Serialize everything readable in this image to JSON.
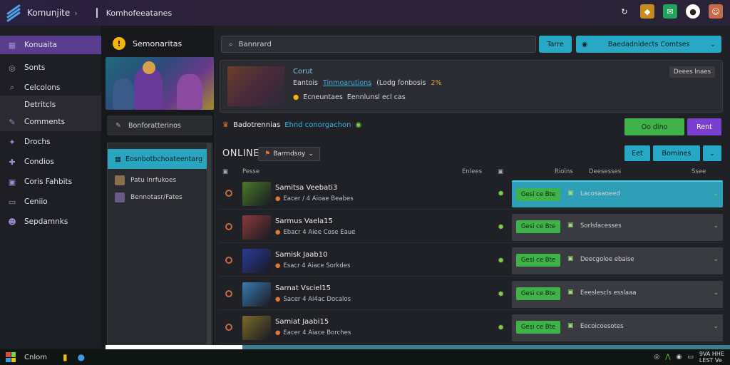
{
  "app": {
    "title": "Komunjite",
    "breadcrumb": "Komhofeeatanes"
  },
  "top_actions": [
    {
      "icon": "refresh-icon",
      "color": "#2a2236",
      "glyph": "↻"
    },
    {
      "icon": "badge-icon",
      "color": "#c78a1e",
      "glyph": "◆"
    },
    {
      "icon": "chat-icon",
      "color": "#1fa35a",
      "glyph": "✉"
    },
    {
      "icon": "user-icon",
      "color": "#ffffff",
      "glyph": "●"
    },
    {
      "icon": "avatar-icon",
      "color": "#c46a4a",
      "glyph": "☺"
    }
  ],
  "sidebar": {
    "items": [
      {
        "label": "Konuaita",
        "icon": "grid-icon",
        "glyph": "▦",
        "state": "active"
      },
      {
        "label": "Sonts",
        "icon": "compass-icon",
        "glyph": "◎",
        "state": ""
      },
      {
        "label": "Celcolons",
        "icon": "search-icon",
        "glyph": "⌕",
        "state": ""
      },
      {
        "label": "Detritcls",
        "icon": "",
        "glyph": "",
        "state": "sub"
      },
      {
        "label": "Comments",
        "icon": "chat-icon",
        "glyph": "✎",
        "state": "sub"
      },
      {
        "label": "Drochs",
        "icon": "sword-icon",
        "glyph": "✦",
        "state": ""
      },
      {
        "label": "Condios",
        "icon": "controller-icon",
        "glyph": "✚",
        "state": ""
      },
      {
        "label": "Coris Fahbits",
        "icon": "cube-icon",
        "glyph": "▣",
        "state": ""
      },
      {
        "label": "Ceniio",
        "icon": "monitor-icon",
        "glyph": "▭",
        "state": ""
      },
      {
        "label": "Sepdamnks",
        "icon": "avatar-icon",
        "glyph": "☻",
        "state": ""
      }
    ]
  },
  "channels": {
    "header": "Semonaritas",
    "box_label": "Bonforatterinos",
    "selected": "Eosnbotbchoateentarg",
    "rows": [
      "Patu Inrfukoes",
      "Bennotasr/Fates"
    ]
  },
  "main": {
    "search_placeholder": "Bannrard",
    "search_button": "Tarre",
    "dropdown_label": "Baedadnidects Comtses",
    "featured": {
      "title": "Corut",
      "line1_a": "Eantois",
      "line1_hl": "Tinmoarutions",
      "line1_b": "(Lodg fonbosis",
      "line1_pct": "2%",
      "line2": "Ecneuntaes",
      "line2_b": "Eennlunsl ecl cas",
      "badge": "Deees lnaes"
    },
    "info": {
      "left": "Badotrennias",
      "highlight": "Ehnd conorgachon"
    },
    "green_button": "Oo dino",
    "purple_button": "Rent",
    "online_label": "ONLINE",
    "online_filter": "Barmdsoy",
    "btn_small": "Eet",
    "btn_medium": "Bomines",
    "table_headers": {
      "col1": "Pesse",
      "col2": "Enlees",
      "col3": "Riolns",
      "col4": "Deesesses",
      "col5": "Ssee"
    },
    "rows": [
      {
        "name": "Samitsa Veebati3",
        "sub": "Eacer / 4 Aioae Beabes",
        "action": "Gesi ce Bte",
        "panel": "Lacosaaoeed",
        "selected": true,
        "thumb": "#4a7a2a"
      },
      {
        "name": "Sarmus Vaela15",
        "sub": "Ebacr 4 Aiee Cose Eaue",
        "action": "Gesi ce Bte",
        "panel": "Sorlsfacesses",
        "selected": false,
        "thumb": "#8a3a3a"
      },
      {
        "name": "Samisk Jaab10",
        "sub": "Esacr 4 Aiace Sorkdes",
        "action": "Gesi ce Bte",
        "panel": "Deecgoloe ebaise",
        "selected": false,
        "thumb": "#2a3a9a"
      },
      {
        "name": "Sarnat Vsciel15",
        "sub": "Sacer 4 Ai4ac Docalos",
        "action": "Gesi ce Bte",
        "panel": "Eeeslescls esslaaa",
        "selected": false,
        "thumb": "#3a7ab0"
      },
      {
        "name": "Samiat Jaabi15",
        "sub": "Eacer 4 Aiace Borches",
        "action": "Gesi ce Bte",
        "panel": "Eecoicoesotes",
        "selected": false,
        "thumb": "#7a6a2a"
      }
    ]
  },
  "taskbar": {
    "label": "Cnlom",
    "tray_time": "9VA HHE",
    "tray_date": "LEST Ve"
  }
}
